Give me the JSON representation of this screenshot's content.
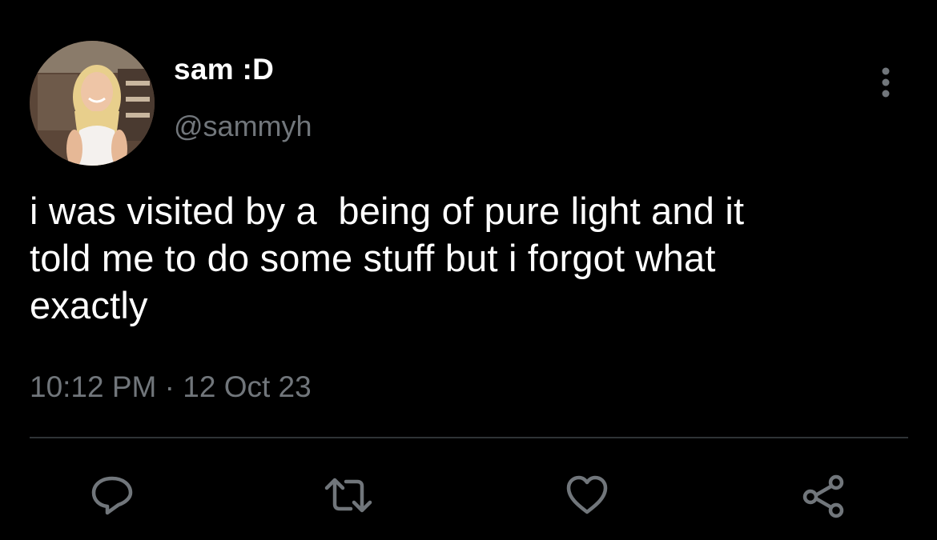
{
  "tweet": {
    "display_name": "sam :D",
    "handle": "@sammyh",
    "text": "i was visited by a  being of pure light and it\ntold me to do some stuff but i forgot what\nexactly",
    "time": "10:12 PM",
    "separator": " · ",
    "date": "12 Oct 23"
  },
  "actions": {
    "reply_icon": "reply-icon",
    "retweet_icon": "retweet-icon",
    "like_icon": "heart-icon",
    "share_icon": "share-icon",
    "more_icon": "more-vertical-icon"
  },
  "colors": {
    "background": "#000000",
    "primary_text": "#ffffff",
    "secondary_text": "#71767b",
    "divider": "#2f3336"
  }
}
